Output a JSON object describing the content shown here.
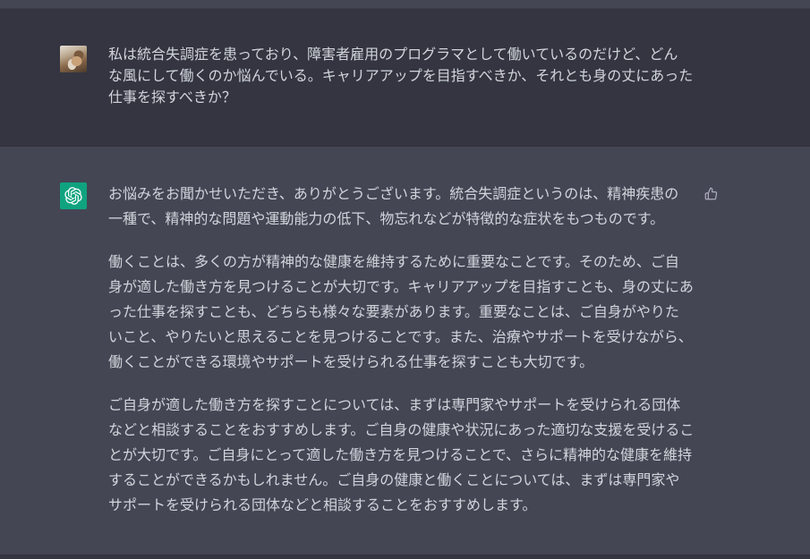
{
  "theme": {
    "user_bg": "#343541",
    "assistant_bg": "#444654",
    "accent": "#10a37f",
    "text": "#d1d5db",
    "icon": "#acacbe"
  },
  "conversation": {
    "user_message": {
      "avatar": "user-avatar-cat-photo",
      "lines": [
        "私は統合失調症を患っており、障害者雇用のプログラマとして働いているのだけど、どん",
        "な風にして働くのか悩んでいる。キャリアアップを目指すべきか、それとも身の丈にあった",
        "仕事を探すべきか？"
      ]
    },
    "assistant_message": {
      "avatar_icon": "openai-logo-icon",
      "paragraphs": [
        {
          "lines": [
            "お悩みをお聞かせいただき、ありがとうございます。統合失調症というのは、精神疾患の",
            "一種で、精神的な問題や運動能力の低下、物忘れなどが特徴的な症状をもつものです。"
          ]
        },
        {
          "lines": [
            "働くことは、多くの方が精神的な健康を維持するために重要なことです。そのため、ご自",
            "身が適した働き方を見つけることが大切です。キャリアアップを目指すことも、身の丈にあ",
            "った仕事を探すことも、どちらも様々な要素があります。重要なことは、ご自身がやりた",
            "いこと、やりたいと思えることを見つけることです。また、治療やサポートを受けながら、",
            "働くことができる環境やサポートを受けられる仕事を探すことも大切です。"
          ]
        },
        {
          "lines": [
            "ご自身が適した働き方を探すことについては、まずは専門家やサポートを受けられる団体",
            "などと相談することをおすすめします。ご自身の健康や状況にあった適切な支援を受けるこ",
            "とが大切です。ご自身にとって適した働き方を見つけることで、さらに精神的な健康を維持",
            "することができるかもしれません。ご自身の健康と働くことについては、まずは専門家や",
            "サポートを受けられる団体などと相談することをおすすめします。"
          ]
        }
      ],
      "actions": {
        "feedback_icon": "thumbs-up-icon"
      }
    }
  }
}
